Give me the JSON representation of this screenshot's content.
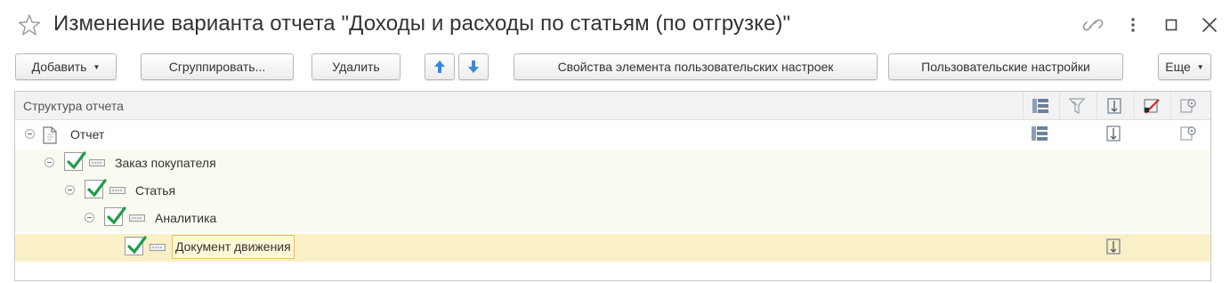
{
  "window": {
    "title": "Изменение варианта отчета \"Доходы и расходы по статьям (по отгрузке)\""
  },
  "toolbar": {
    "add_label": "Добавить",
    "group_label": "Сгруппировать...",
    "delete_label": "Удалить",
    "properties_label": "Свойства элемента пользовательских настроек",
    "user_settings_label": "Пользовательские настройки",
    "more_label": "Еще"
  },
  "grid": {
    "header_label": "Структура отчета",
    "column_icons": [
      "grouping-fields-icon",
      "filter-icon",
      "fields-order-icon",
      "conditional-appearance-icon",
      "other-settings-icon"
    ],
    "rows": [
      {
        "label": "Отчет"
      },
      {
        "label": "Заказ покупателя"
      },
      {
        "label": "Статья"
      },
      {
        "label": "Аналитика"
      },
      {
        "label": "Документ движения"
      }
    ]
  },
  "colors": {
    "accent_blue": "#4a90d9",
    "check_green": "#1e9c4a",
    "selected_row": "#faf0c8"
  }
}
